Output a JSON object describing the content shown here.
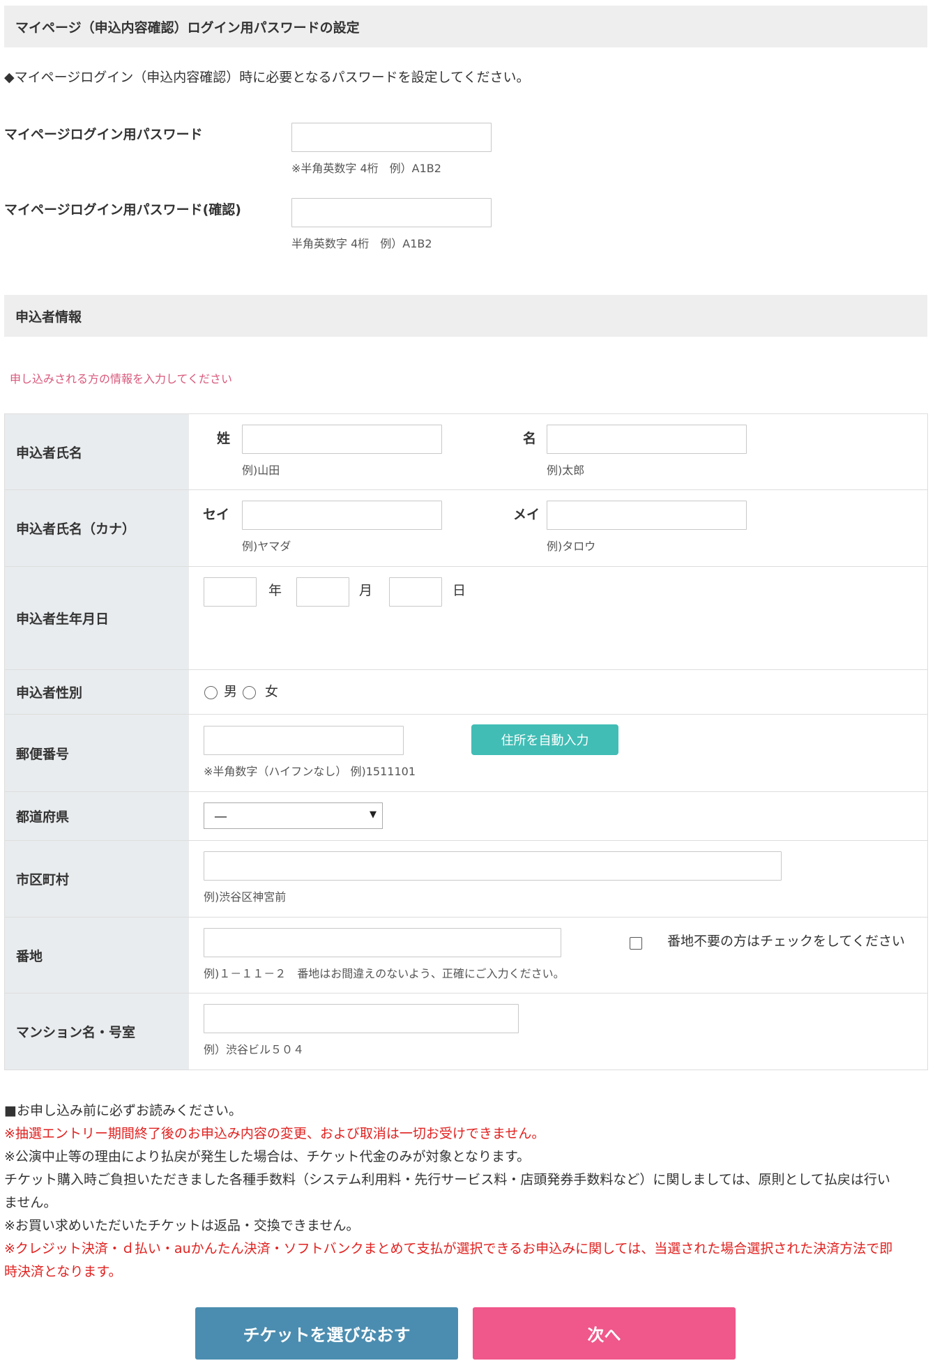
{
  "password_section": {
    "header": "マイページ（申込内容確認）ログイン用パスワードの設定",
    "intro": "◆マイページログイン（申込内容確認）時に必要となるパスワードを設定してください。",
    "password_label": "マイページログイン用パスワード",
    "password_value": "",
    "password_hint": "※半角英数字 4桁　例）A1B2",
    "confirm_label": "マイページログイン用パスワード(確認)",
    "confirm_value": "",
    "confirm_hint": "半角英数字 4桁　例）A1B2"
  },
  "applicant_section": {
    "header": "申込者情報",
    "subtitle": "申し込みされる方の情報を入力してください",
    "subtitle_color": "#d9587b"
  },
  "form": {
    "name": {
      "label": "申込者氏名",
      "sei_label": "姓",
      "sei_value": "",
      "sei_hint": "例)山田",
      "mei_label": "名",
      "mei_value": "",
      "mei_hint": "例)太郎"
    },
    "kana": {
      "label": "申込者氏名（カナ）",
      "sei_label": "セイ",
      "sei_value": "",
      "sei_hint": "例)ヤマダ",
      "mei_label": "メイ",
      "mei_value": "",
      "mei_hint": "例)タロウ"
    },
    "birthday": {
      "label": "申込者生年月日",
      "year_label": "年",
      "month_label": "月",
      "day_label": "日",
      "year_value": "",
      "month_value": "",
      "day_value": ""
    },
    "gender": {
      "label": "申込者性別",
      "male_label": "男",
      "female_label": "女",
      "male_selected": false,
      "female_selected": false
    },
    "postal": {
      "label": "郵便番号",
      "value": "",
      "hint": "※半角数字（ハイフンなし） 例)1511101",
      "auto_button": "住所を自動入力",
      "auto_button_color": "#41bdb5"
    },
    "prefecture": {
      "label": "都道府県",
      "selected": "—"
    },
    "city": {
      "label": "市区町村",
      "value": "",
      "hint": "例)渋谷区神宮前"
    },
    "address": {
      "label": "番地",
      "value": "",
      "hint": "例)１－１１－２　番地はお間違えのないよう、正確にご入力ください。",
      "no_address_label": "番地不要の方はチェックをしてください",
      "no_address_checked": false
    },
    "building": {
      "label": "マンション名・号室",
      "value": "",
      "hint": "例）渋谷ビル５０４"
    }
  },
  "notices": {
    "line1": "■お申し込み前に必ずお読みください。",
    "line2": "※抽選エントリー期間終了後のお申込み内容の変更、および取消は一切お受けできません。",
    "line3": "※公演中止等の理由により払戻が発生した場合は、チケット代金のみが対象となります。",
    "line4": "チケット購入時ご負担いただきました各種手数料（システム利用料・先行サービス料・店頭発券手数料など）に関しましては、原則として払戻は行い",
    "line5": "ません。",
    "line6": "※お買い求めいただいたチケットは返品・交換できません。",
    "line7": "※クレジット決済・ｄ払い・auかんたん決済・ソフトバンクまとめて支払が選択できるお申込みに関しては、当選された場合選択された決済方法で即",
    "line8": "時決済となります。",
    "red_color": "#e0211f"
  },
  "buttons": {
    "back": "チケットを選びなおす",
    "back_color": "#4b8db0",
    "next": "次へ",
    "next_color": "#f0578a"
  }
}
